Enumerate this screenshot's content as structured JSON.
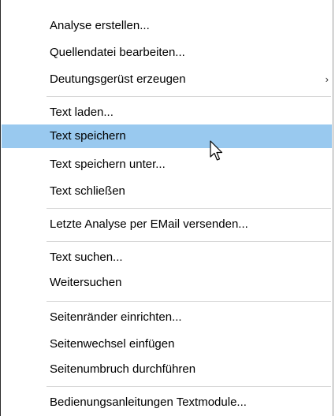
{
  "menu": {
    "items": [
      {
        "label": "Analyse erstellen..."
      },
      {
        "label": "Quellendatei bearbeiten..."
      },
      {
        "label": "Deutungsgerüst erzeugen",
        "submenu_arrow": "›"
      },
      {
        "label": "Text laden..."
      },
      {
        "label": "Text speichern",
        "highlighted": true
      },
      {
        "label": "Text speichern unter..."
      },
      {
        "label": "Text schließen"
      },
      {
        "label": "Letzte Analyse per EMail versenden..."
      },
      {
        "label": "Text suchen..."
      },
      {
        "label": "Weitersuchen"
      },
      {
        "label": "Seitenränder einrichten..."
      },
      {
        "label": "Seitenwechsel einfügen"
      },
      {
        "label": "Seitenumbruch durchführen"
      },
      {
        "label": "Bedienungsanleitungen Textmodule..."
      }
    ]
  },
  "colors": {
    "highlight": "#99c9ef",
    "separator": "#d7d7d7"
  },
  "icons": {
    "submenu": "chevron-right-icon",
    "pointer": "mouse-cursor-icon"
  }
}
